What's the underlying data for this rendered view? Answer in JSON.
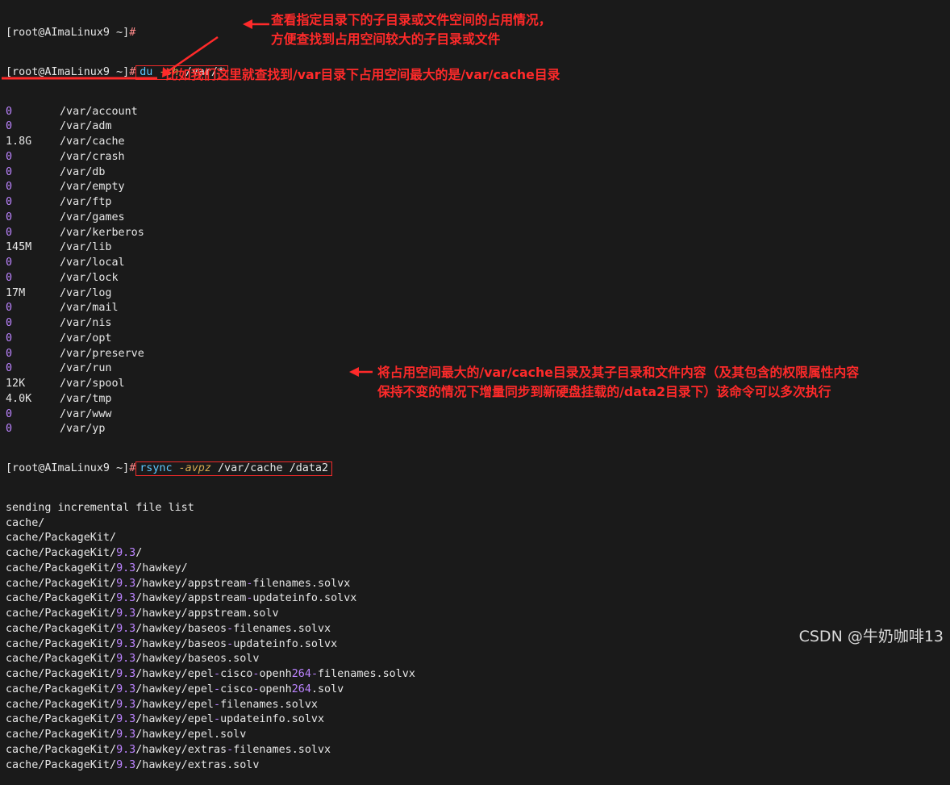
{
  "terminal": {
    "prompt": "[root@AImaLinux9 ~]",
    "prompt_hash": "#",
    "du_command": {
      "cmd": "du",
      "flag": "-sh",
      "arg": "/var/*"
    },
    "du_output": [
      {
        "size": "0",
        "path": "/var/account"
      },
      {
        "size": "0",
        "path": "/var/adm"
      },
      {
        "size": "1.8G",
        "path": "/var/cache"
      },
      {
        "size": "0",
        "path": "/var/crash"
      },
      {
        "size": "0",
        "path": "/var/db"
      },
      {
        "size": "0",
        "path": "/var/empty"
      },
      {
        "size": "0",
        "path": "/var/ftp"
      },
      {
        "size": "0",
        "path": "/var/games"
      },
      {
        "size": "0",
        "path": "/var/kerberos"
      },
      {
        "size": "145M",
        "path": "/var/lib"
      },
      {
        "size": "0",
        "path": "/var/local"
      },
      {
        "size": "0",
        "path": "/var/lock"
      },
      {
        "size": "17M",
        "path": "/var/log"
      },
      {
        "size": "0",
        "path": "/var/mail"
      },
      {
        "size": "0",
        "path": "/var/nis"
      },
      {
        "size": "0",
        "path": "/var/opt"
      },
      {
        "size": "0",
        "path": "/var/preserve"
      },
      {
        "size": "0",
        "path": "/var/run"
      },
      {
        "size": "12K",
        "path": "/var/spool"
      },
      {
        "size": "4.0K",
        "path": "/var/tmp"
      },
      {
        "size": "0",
        "path": "/var/www"
      },
      {
        "size": "0",
        "path": "/var/yp"
      }
    ],
    "rsync_command": {
      "cmd": "rsync",
      "flag": "-avpz",
      "arg1": "/var/cache",
      "arg2": "/data2"
    },
    "rsync_output": [
      "sending incremental file list",
      "cache/",
      "cache/PackageKit/",
      "cache/PackageKit/9.3/",
      "cache/PackageKit/9.3/hawkey/",
      "cache/PackageKit/9.3/hawkey/appstream-filenames.solvx",
      "cache/PackageKit/9.3/hawkey/appstream-updateinfo.solvx",
      "cache/PackageKit/9.3/hawkey/appstream.solv",
      "cache/PackageKit/9.3/hawkey/baseos-filenames.solvx",
      "cache/PackageKit/9.3/hawkey/baseos-updateinfo.solvx",
      "cache/PackageKit/9.3/hawkey/baseos.solv",
      "cache/PackageKit/9.3/hawkey/epel-cisco-openh264-filenames.solvx",
      "cache/PackageKit/9.3/hawkey/epel-cisco-openh264.solv",
      "cache/PackageKit/9.3/hawkey/epel-filenames.solvx",
      "cache/PackageKit/9.3/hawkey/epel-updateinfo.solvx",
      "cache/PackageKit/9.3/hawkey/epel.solv",
      "cache/PackageKit/9.3/hawkey/extras-filenames.solvx",
      "cache/PackageKit/9.3/hawkey/extras.solv"
    ]
  },
  "annotations": {
    "du_note": "查看指定目录下的子目录或文件空间的占用情况，\n方便查找到占用空间较大的子目录或文件",
    "cache_note": "比如我们这里就查找到/var目录下占用空间最大的是/var/cache目录",
    "rsync_note": "将占用空间最大的/var/cache目录及其子目录和文件内容（及其包含的权限属性内容\n保持不变的情况下增量同步到新硬盘挂载的/data2目录下）该命令可以多次执行",
    "color": "#ff2a2a"
  },
  "watermark": "CSDN @牛奶咖啡13",
  "colors": {
    "background": "#1a1a1a",
    "text": "#e6e6e6",
    "number": "#bc84ff",
    "command": "#5ec8ff",
    "flag": "#d6a84f",
    "highlight": "#f02a2a"
  }
}
